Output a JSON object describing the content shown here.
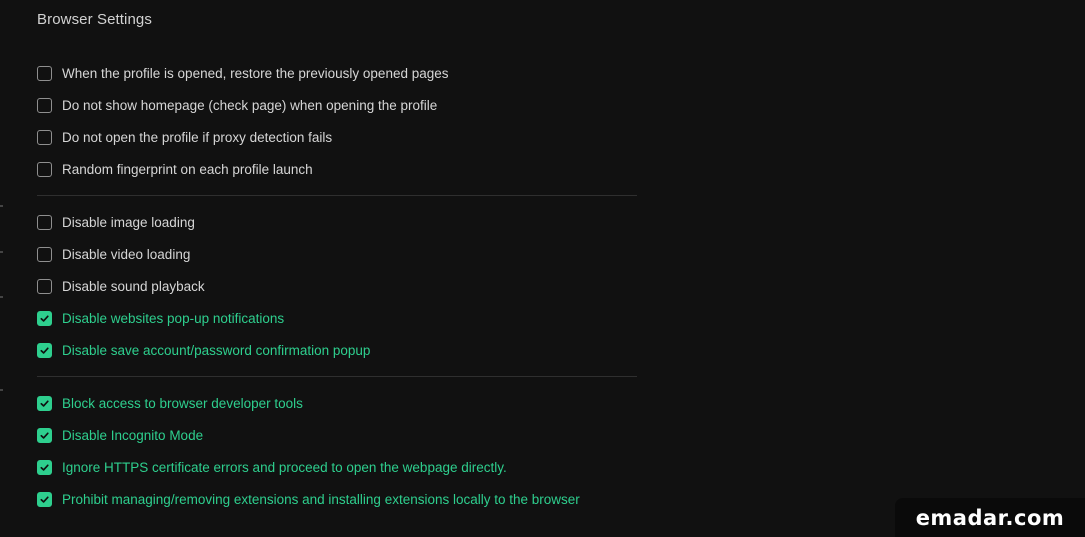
{
  "section": {
    "title": "Browser Settings"
  },
  "groups": [
    {
      "items": [
        {
          "label": "When the profile is opened, restore the previously opened pages",
          "checked": false
        },
        {
          "label": "Do not show homepage (check page) when opening the profile",
          "checked": false
        },
        {
          "label": "Do not open the profile if proxy detection fails",
          "checked": false
        },
        {
          "label": "Random fingerprint on each profile launch",
          "checked": false
        }
      ]
    },
    {
      "items": [
        {
          "label": "Disable image loading",
          "checked": false
        },
        {
          "label": "Disable video loading",
          "checked": false
        },
        {
          "label": "Disable sound playback",
          "checked": false
        },
        {
          "label": "Disable websites pop-up notifications",
          "checked": true
        },
        {
          "label": "Disable save account/password confirmation popup",
          "checked": true
        }
      ]
    },
    {
      "items": [
        {
          "label": "Block access to browser developer tools",
          "checked": true
        },
        {
          "label": "Disable Incognito Mode",
          "checked": true
        },
        {
          "label": "Ignore HTTPS certificate errors and proceed to open the webpage directly.",
          "checked": true
        },
        {
          "label": "Prohibit managing/removing extensions and installing extensions locally to the browser",
          "checked": true
        }
      ]
    }
  ],
  "watermark": {
    "text": "emadar.com"
  },
  "colors": {
    "accent": "#2ecf8e",
    "background": "#111111",
    "text": "#d6d6d6",
    "checkbox_border": "#8f8f8f",
    "divider": "#2f2f2f"
  },
  "icons": {
    "checkbox_check": "checkmark-icon"
  }
}
